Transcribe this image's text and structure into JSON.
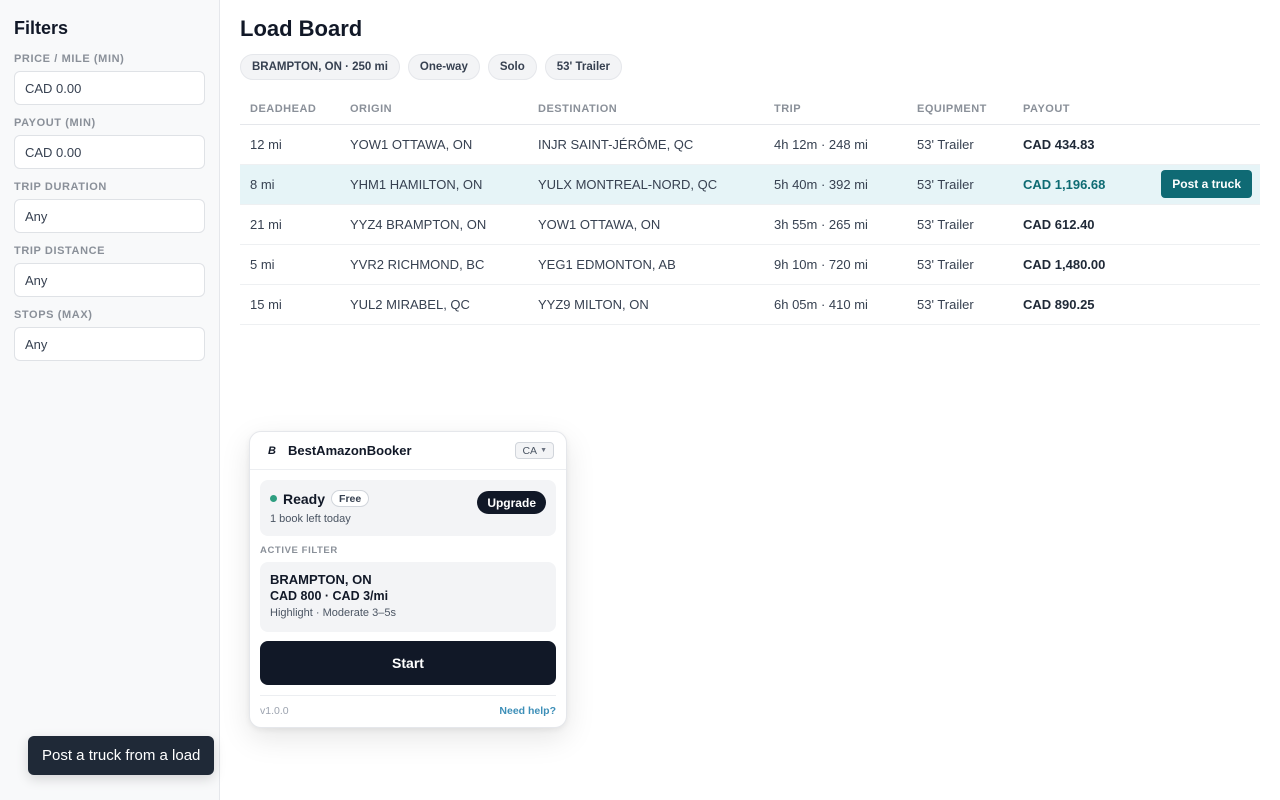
{
  "sidebar": {
    "title": "Filters",
    "filters": [
      {
        "label": "PRICE / MILE (MIN)",
        "value": "CAD 0.00"
      },
      {
        "label": "PAYOUT (MIN)",
        "value": "CAD 0.00"
      },
      {
        "label": "TRIP DURATION",
        "value": "Any"
      },
      {
        "label": "TRIP DISTANCE",
        "value": "Any"
      },
      {
        "label": "STOPS (MAX)",
        "value": "Any"
      }
    ]
  },
  "main": {
    "title": "Load Board",
    "chips": [
      "BRAMPTON, ON · 250 mi",
      "One-way",
      "Solo",
      "53' Trailer"
    ],
    "columns": [
      "DEADHEAD",
      "ORIGIN",
      "DESTINATION",
      "TRIP",
      "EQUIPMENT",
      "PAYOUT"
    ],
    "rows": [
      {
        "deadhead": "12 mi",
        "origin": "YOW1 OTTAWA, ON",
        "destination": "INJR SAINT-JÉRÔME, QC",
        "trip": "4h 12m · 248 mi",
        "equipment": "53' Trailer",
        "payout": "CAD 434.83"
      },
      {
        "deadhead": "8 mi",
        "origin": "YHM1 HAMILTON, ON",
        "destination": "YULX MONTREAL-NORD, QC",
        "trip": "5h 40m · 392 mi",
        "equipment": "53' Trailer",
        "payout": "CAD 1,196.68",
        "action": "Post a truck"
      },
      {
        "deadhead": "21 mi",
        "origin": "YYZ4 BRAMPTON, ON",
        "destination": "YOW1 OTTAWA, ON",
        "trip": "3h 55m · 265 mi",
        "equipment": "53' Trailer",
        "payout": "CAD 612.40"
      },
      {
        "deadhead": "5 mi",
        "origin": "YVR2 RICHMOND, BC",
        "destination": "YEG1 EDMONTON, AB",
        "trip": "9h 10m · 720 mi",
        "equipment": "53' Trailer",
        "payout": "CAD 1,480.00"
      },
      {
        "deadhead": "15 mi",
        "origin": "YUL2 MIRABEL, QC",
        "destination": "YYZ9 MILTON, ON",
        "trip": "6h 05m · 410 mi",
        "equipment": "53' Trailer",
        "payout": "CAD 890.25"
      }
    ]
  },
  "popup": {
    "logo_glyph": "B",
    "brand": "BestAmazonBooker",
    "region": "CA",
    "status": "Ready",
    "badge": "Free",
    "status_sub": "1 book left today",
    "upgrade_label": "Upgrade",
    "section_label": "ACTIVE FILTER",
    "filter_title": "BRAMPTON, ON",
    "filter_sub": "CAD 800 · CAD 3/mi",
    "filter_note": "Highlight · Moderate 3–5s",
    "start_label": "Start",
    "version": "v1.0.0",
    "help_label": "Need help?"
  },
  "toast": {
    "text": "Post a truck from a load"
  },
  "colors": {
    "accent": "#0f6a74",
    "highlight_row": "#e6f4f7",
    "status_dot": "#2e9e80",
    "dark": "#111827",
    "link": "#3d8fb8"
  }
}
